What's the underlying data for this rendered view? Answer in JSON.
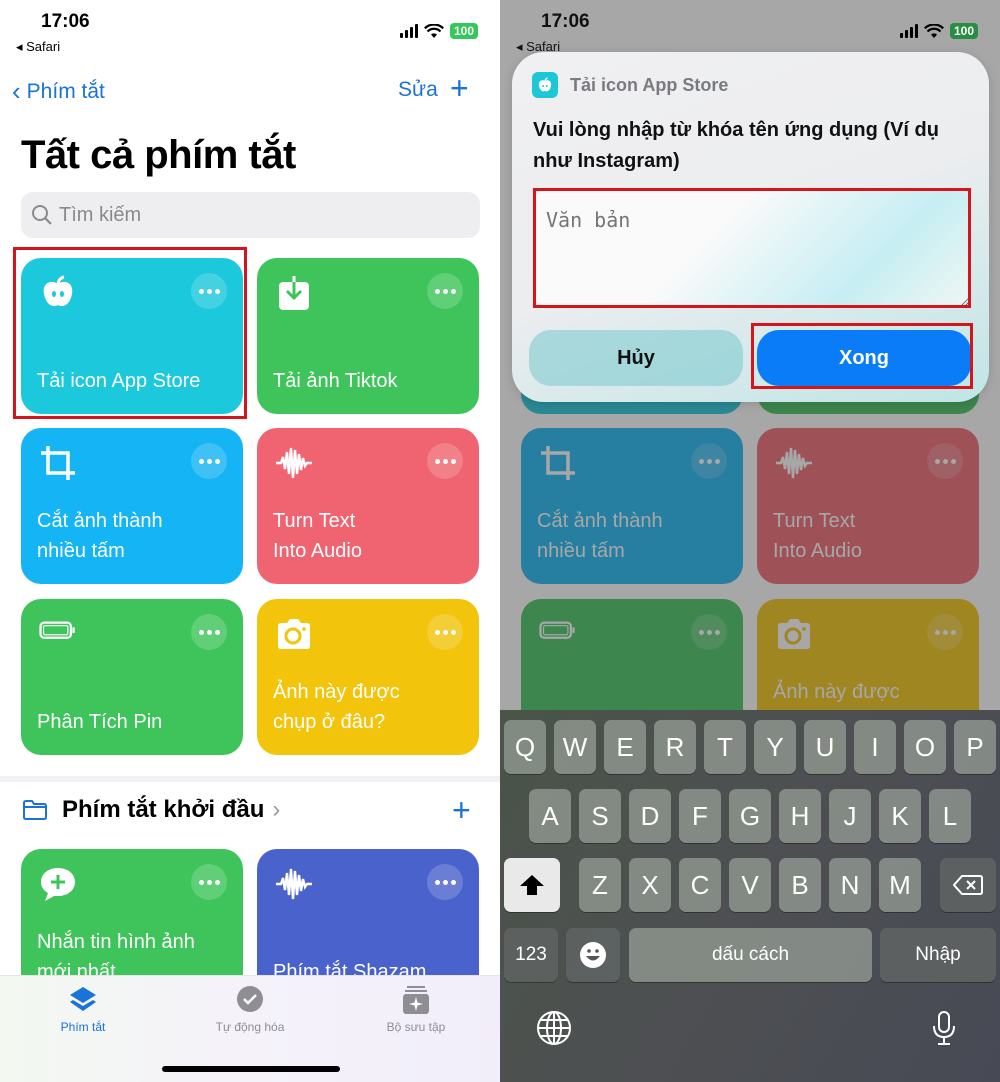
{
  "left": {
    "status": {
      "time": "17:06",
      "back_app": "Safari",
      "battery": "100"
    },
    "nav": {
      "back_label": "Phím tắt",
      "edit_label": "Sửa",
      "add_icon": "plus-icon"
    },
    "title": "Tất cả phím tắt",
    "search": {
      "placeholder": "Tìm kiếm"
    },
    "shortcuts": [
      {
        "label": "Tải icon App Store",
        "icon": "apple-icon",
        "color": "#1cc8dc",
        "highlighted": true
      },
      {
        "label": "Tải ảnh Tiktok",
        "icon": "download-icon",
        "color": "#3fc45b"
      },
      {
        "label": "Cắt ảnh thành\nnhiều tấm",
        "icon": "crop-icon",
        "color": "#15b4f5"
      },
      {
        "label": "Turn Text\nInto Audio",
        "icon": "waveform-icon",
        "color": "#ef6470"
      },
      {
        "label": "Phân Tích Pin",
        "icon": "battery-icon",
        "color": "#3fc45b"
      },
      {
        "label": "Ảnh này được\nchụp ở đâu?",
        "icon": "camera-icon",
        "color": "#f2c40c"
      },
      {
        "label": "Nhắn tin hình ảnh\nmới nhất",
        "icon": "message-plus-icon",
        "color": "#3fc45b"
      },
      {
        "label": "Phím tắt Shazam",
        "icon": "waveform-icon",
        "color": "#4a62cc"
      }
    ],
    "section": {
      "title": "Phím tắt khởi đầu"
    },
    "tabs": [
      {
        "label": "Phím tắt",
        "icon": "layers-icon",
        "active": true
      },
      {
        "label": "Tự động hóa",
        "icon": "clock-check-icon",
        "active": false
      },
      {
        "label": "Bộ sưu tập",
        "icon": "sparkle-gallery-icon",
        "active": false
      }
    ]
  },
  "right": {
    "status": {
      "time": "17:06",
      "back_app": "Safari",
      "battery": "100"
    },
    "dialog": {
      "app_name": "Tải icon App Store",
      "prompt": "Vui lòng nhập từ khóa tên ứng dụng (Ví dụ như Instagram)",
      "input_placeholder": "Văn bản",
      "input_value": "",
      "cancel_label": "Hủy",
      "done_label": "Xong"
    },
    "keyboard": {
      "row1": [
        "Q",
        "W",
        "E",
        "R",
        "T",
        "Y",
        "U",
        "I",
        "O",
        "P"
      ],
      "row2": [
        "A",
        "S",
        "D",
        "F",
        "G",
        "H",
        "J",
        "K",
        "L"
      ],
      "row3": [
        "Z",
        "X",
        "C",
        "V",
        "B",
        "N",
        "M"
      ],
      "numbers_label": "123",
      "space_label": "dấu cách",
      "return_label": "Nhập"
    }
  },
  "colors": {
    "accent": "#1a73d9",
    "done_button": "#0a7cf8",
    "highlight_box": "#d4161c"
  }
}
